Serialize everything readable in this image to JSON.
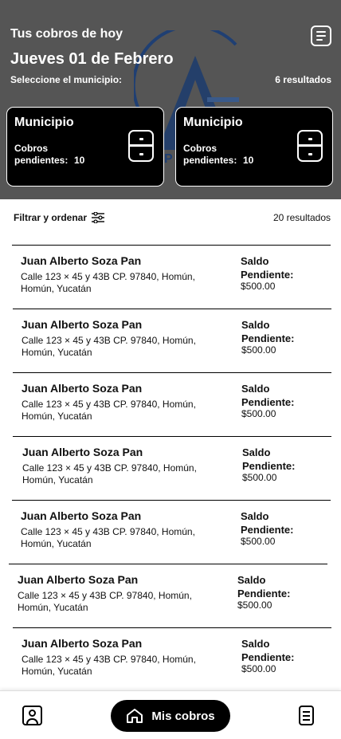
{
  "header": {
    "title": "Tus cobros de hoy",
    "date": "Jueves 01 de Febrero",
    "select_prompt": "Seleccione el municipio:",
    "results": "6 resultados",
    "menu_icon": "list-document-icon"
  },
  "municipios": [
    {
      "title": "Municipio",
      "sub_label": "Cobros pendientes:",
      "count": "10",
      "icon": "cabinet-icon"
    },
    {
      "title": "Municipio",
      "sub_label": "Cobros pendientes:",
      "count": "10",
      "icon": "cabinet-icon"
    }
  ],
  "filter": {
    "label": "Filtrar y ordenar",
    "icon": "sliders-icon",
    "results": "20 resultados"
  },
  "list": [
    {
      "name": "Juan Alberto Soza Pan",
      "address": "Calle 123 × 45 y 43B CP. 97840, Homún, Homún, Yucatán",
      "saldo_label": "Saldo Pendiente:",
      "amount": "$500.00"
    },
    {
      "name": "Juan Alberto Soza Pan",
      "address": "Calle 123 × 45 y 43B CP. 97840, Homún, Homún, Yucatán",
      "saldo_label": "Saldo Pendiente:",
      "amount": "$500.00"
    },
    {
      "name": "Juan Alberto Soza Pan",
      "address": "Calle 123 × 45 y 43B CP. 97840, Homún, Homún, Yucatán",
      "saldo_label": "Saldo Pendiente:",
      "amount": "$500.00"
    },
    {
      "name": "Juan Alberto Soza Pan",
      "address": "Calle 123 × 45 y 43B CP. 97840, Homún, Homún, Yucatán",
      "saldo_label": "Saldo Pendiente:",
      "amount": "$500.00"
    },
    {
      "name": "Juan Alberto Soza Pan",
      "address": "Calle 123 × 45 y 43B CP. 97840, Homún, Homún, Yucatán",
      "saldo_label": "Saldo Pendiente:",
      "amount": "$500.00"
    },
    {
      "name": "Juan Alberto Soza Pan",
      "address": "Calle 123 × 45 y 43B CP. 97840, Homún, Homún, Yucatán",
      "saldo_label": "Saldo Pendiente:",
      "amount": "$500.00"
    },
    {
      "name": "Juan Alberto Soza Pan",
      "address": "Calle 123 × 45 y 43B CP. 97840, Homún, Homún, Yucatán",
      "saldo_label": "Saldo Pendiente:",
      "amount": "$500.00"
    }
  ],
  "nav": {
    "profile_icon": "user-profile-icon",
    "main_label": "Mis cobros",
    "main_icon": "home-icon",
    "docs_icon": "document-icon"
  },
  "colors": {
    "header_bg": "#555555",
    "card_bg": "#000000",
    "logo_blue": "#1f3f73"
  }
}
